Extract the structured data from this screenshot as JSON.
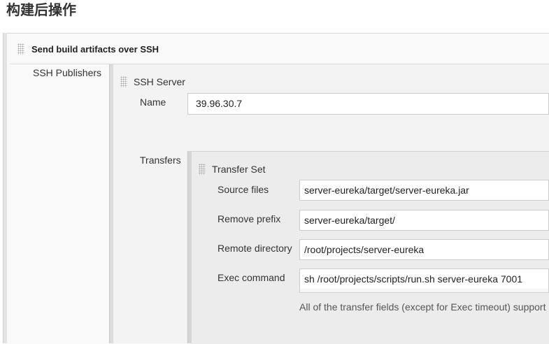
{
  "page": {
    "title": "构建后操作"
  },
  "publisher": {
    "title": "Send build artifacts over SSH",
    "publishers_label": "SSH Publishers"
  },
  "server": {
    "title": "SSH Server",
    "name_label": "Name",
    "name_value": "39.96.30.7",
    "transfers_label": "Transfers"
  },
  "transfer_set": {
    "title": "Transfer Set",
    "source_files_label": "Source files",
    "source_files_value": "server-eureka/target/server-eureka.jar",
    "remove_prefix_label": "Remove prefix",
    "remove_prefix_value": "server-eureka/target/",
    "remote_directory_label": "Remote directory",
    "remote_directory_value": "/root/projects/server-eureka",
    "exec_command_label": "Exec command",
    "exec_command_value": "sh /root/projects/scripts/run.sh server-eureka 7001",
    "help_text": "All of the transfer fields (except for Exec timeout) support"
  }
}
